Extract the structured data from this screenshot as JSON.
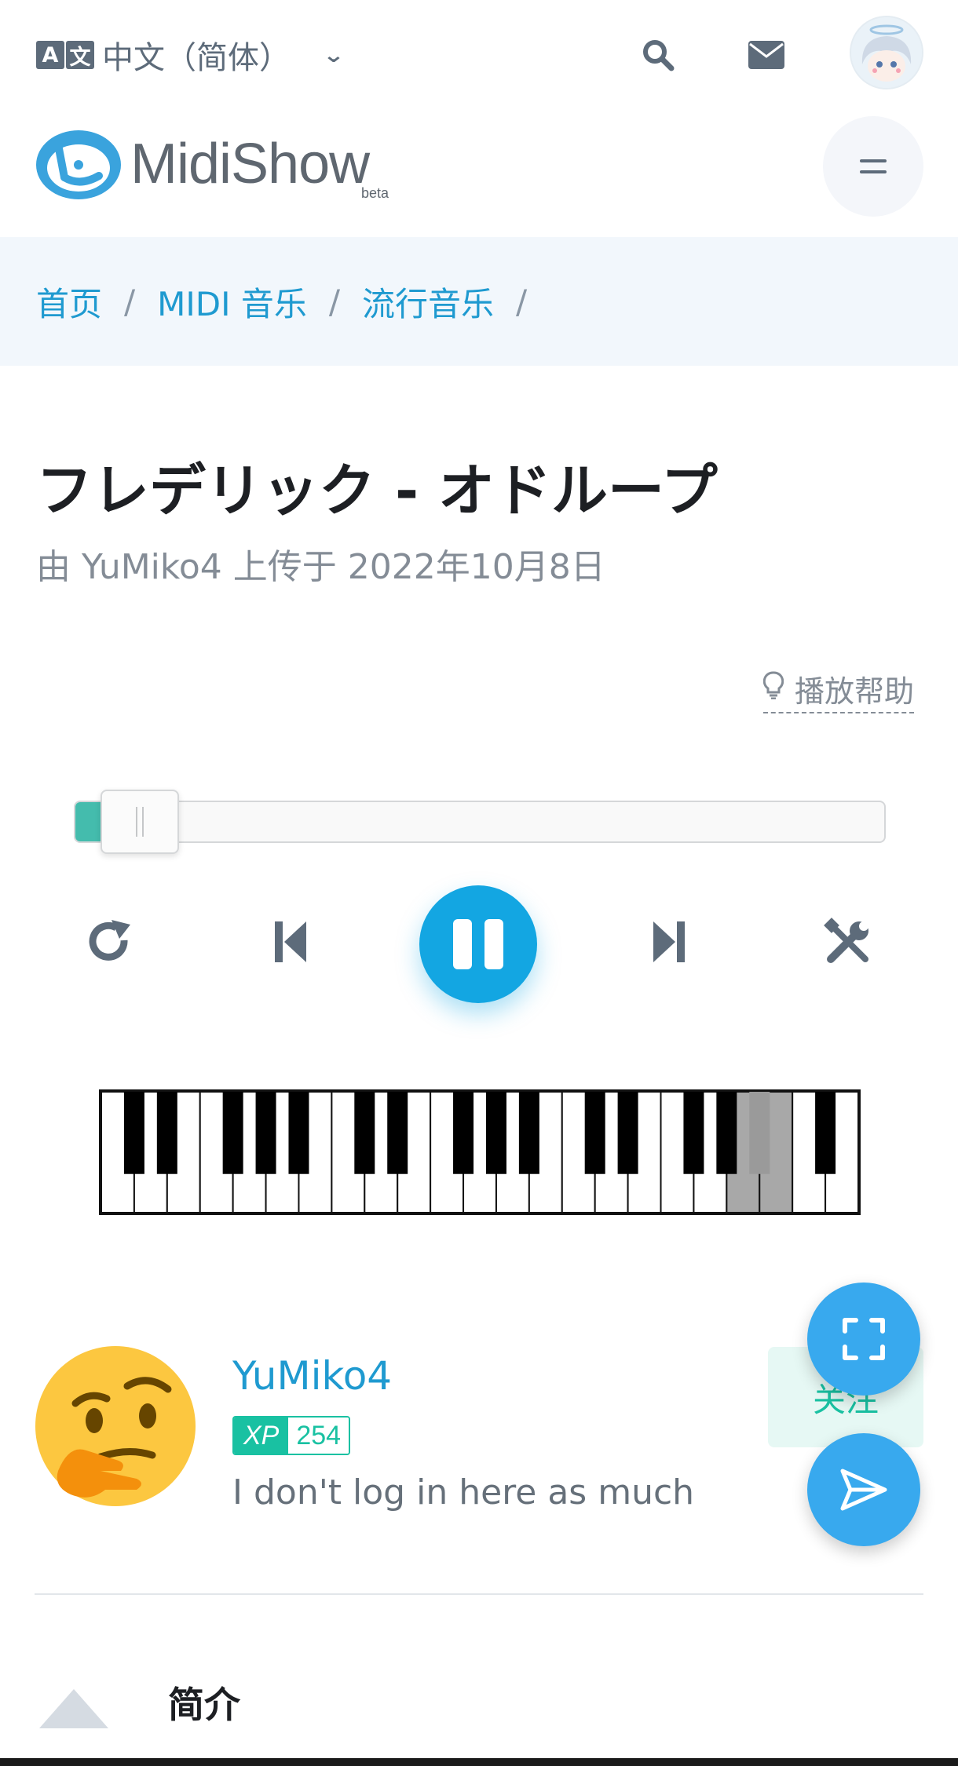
{
  "header": {
    "language_label": "中文（简体）",
    "language_icon_letters": [
      "A",
      "文"
    ],
    "search_icon": "search-icon",
    "mail_icon": "envelope-icon"
  },
  "logo": {
    "text": "MidiShow",
    "badge": "beta"
  },
  "breadcrumb": {
    "items": [
      "首页",
      "MIDI 音乐",
      "流行音乐"
    ],
    "separator": "/"
  },
  "song": {
    "title": "フレデリック - オドループ",
    "uploader_prefix": "由",
    "uploader": "YuMiko4",
    "uploaded_at_prefix": "上传于",
    "uploaded_at": "2022年10月8日"
  },
  "player": {
    "help_label": "播放帮助",
    "progress_fraction": 0.04,
    "state": "playing",
    "controls": [
      "replay-icon",
      "previous-icon",
      "pause-icon",
      "next-icon",
      "tools-icon"
    ],
    "accent_color": "#13a6e2",
    "progress_color": "#44bcad"
  },
  "piano": {
    "white_key_count": 23,
    "pressed_white_keys": [
      19,
      20
    ],
    "pressed_black_keys": [
      19
    ]
  },
  "user": {
    "name": "YuMiko4",
    "xp_label": "XP",
    "xp_value": "254",
    "bio": "I don't log in here as much",
    "follow_label": "关注"
  },
  "fabs": [
    "fullscreen-icon",
    "send-icon"
  ],
  "intro": {
    "title": "简介"
  }
}
